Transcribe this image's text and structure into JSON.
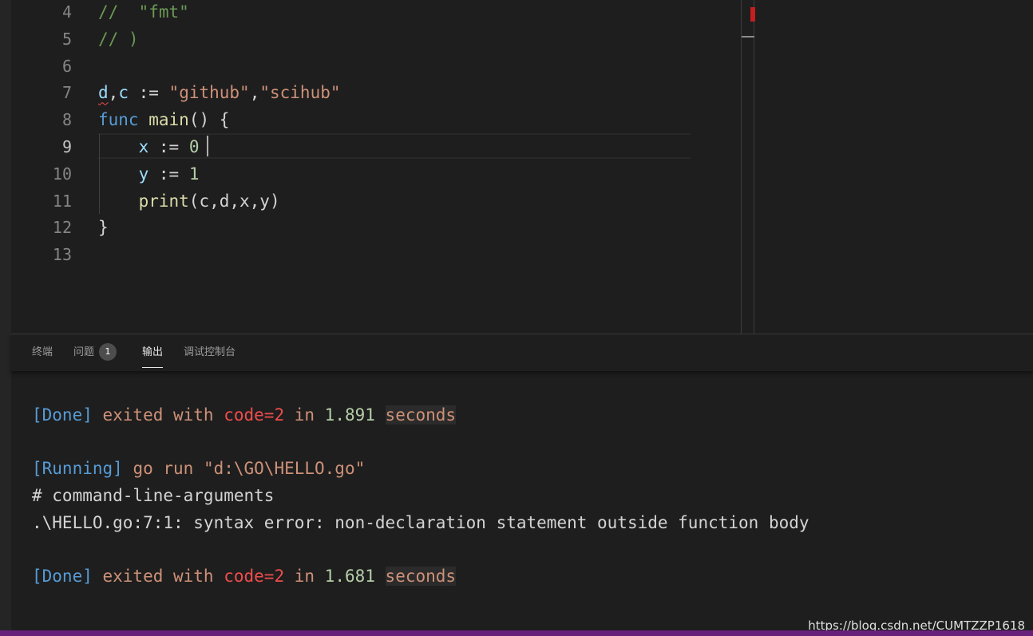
{
  "editor": {
    "lines": [
      {
        "num": "4",
        "tokens": [
          {
            "t": "//  \"fmt\"",
            "c": "comment"
          }
        ]
      },
      {
        "num": "5",
        "tokens": [
          {
            "t": "// )",
            "c": "comment"
          }
        ]
      },
      {
        "num": "6",
        "tokens": []
      },
      {
        "num": "7",
        "tokens": [
          {
            "t": "d",
            "c": "var",
            "squiggle": true
          },
          {
            "t": ",",
            "c": "punc"
          },
          {
            "t": "c",
            "c": "var"
          },
          {
            "t": " := ",
            "c": "punc"
          },
          {
            "t": "\"github\"",
            "c": "str"
          },
          {
            "t": ",",
            "c": "punc"
          },
          {
            "t": "\"scihub\"",
            "c": "str"
          }
        ]
      },
      {
        "num": "8",
        "tokens": [
          {
            "t": "func",
            "c": "kw"
          },
          {
            "t": " ",
            "c": "punc"
          },
          {
            "t": "main",
            "c": "fn"
          },
          {
            "t": "() {",
            "c": "punc"
          }
        ]
      },
      {
        "num": "9",
        "active": true,
        "tokens": [
          {
            "t": "    ",
            "c": "punc"
          },
          {
            "t": "x",
            "c": "var"
          },
          {
            "t": " := ",
            "c": "punc"
          },
          {
            "t": "0",
            "c": "num"
          }
        ]
      },
      {
        "num": "10",
        "tokens": [
          {
            "t": "    ",
            "c": "punc"
          },
          {
            "t": "y",
            "c": "var"
          },
          {
            "t": " := ",
            "c": "punc"
          },
          {
            "t": "1",
            "c": "num"
          }
        ]
      },
      {
        "num": "11",
        "tokens": [
          {
            "t": "    ",
            "c": "punc"
          },
          {
            "t": "print",
            "c": "fn"
          },
          {
            "t": "(c,d,x,y)",
            "c": "punc"
          }
        ]
      },
      {
        "num": "12",
        "tokens": [
          {
            "t": "}",
            "c": "punc"
          }
        ]
      },
      {
        "num": "13",
        "tokens": []
      }
    ]
  },
  "panel": {
    "tabs": [
      {
        "label": "终端",
        "name": "tab-terminal"
      },
      {
        "label": "问题",
        "name": "tab-problems",
        "badge": "1"
      },
      {
        "label": "输出",
        "name": "tab-output",
        "active": true
      },
      {
        "label": "调试控制台",
        "name": "tab-debug-console"
      }
    ],
    "output_lines": [
      [
        {
          "t": "[Done]",
          "c": "tag"
        },
        {
          "t": " exited with ",
          "c": "text"
        },
        {
          "t": "code=2",
          "c": "err"
        },
        {
          "t": " in ",
          "c": "text"
        },
        {
          "t": "1.891",
          "c": "num"
        },
        {
          "t": " ",
          "c": "text"
        },
        {
          "t": "seconds",
          "c": "text",
          "hl": true
        }
      ],
      [],
      [
        {
          "t": "[Running]",
          "c": "tag"
        },
        {
          "t": " go run \"d:\\GO\\HELLO.go\"",
          "c": "text"
        }
      ],
      [
        {
          "t": "# command-line-arguments",
          "c": "plain"
        }
      ],
      [
        {
          "t": ".\\HELLO.go:7:1: syntax error: non-declaration statement outside function body",
          "c": "plain"
        }
      ],
      [],
      [
        {
          "t": "[Done]",
          "c": "tag"
        },
        {
          "t": " exited with ",
          "c": "text"
        },
        {
          "t": "code=2",
          "c": "err"
        },
        {
          "t": " in ",
          "c": "text"
        },
        {
          "t": "1.681",
          "c": "num"
        },
        {
          "t": " ",
          "c": "text"
        },
        {
          "t": "seconds",
          "c": "text",
          "hl": true
        }
      ]
    ]
  },
  "watermark": "https://blog.csdn.net/CUMTZZP1618"
}
